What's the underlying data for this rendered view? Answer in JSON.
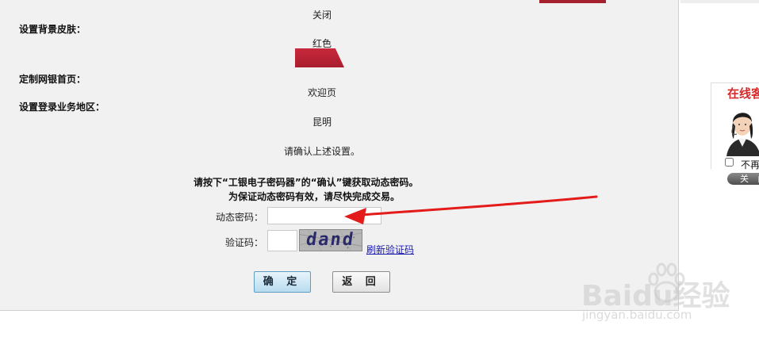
{
  "settings": {
    "skin_label": "设置背景皮肤：",
    "skin_off_value": "关闭",
    "skin_value": "红色",
    "home_label": "定制网银首页：",
    "home_value": "欢迎页",
    "region_label": "设置登录业务地区：",
    "region_value": "昆明"
  },
  "confirm_prompt": "请确认上述设置。",
  "instructions": {
    "line1": "请按下“工银电子密码器”的“确认”键获取动态密码。",
    "line2": "为保证动态密码有效，请尽快完成交易。"
  },
  "form": {
    "dynamic_password_label": "动态密码：",
    "dynamic_password_value": "",
    "captcha_label": "验证码：",
    "captcha_value": "",
    "captcha_image_text": "dand",
    "refresh_captcha_link": "刷新验证码"
  },
  "buttons": {
    "confirm_label": "确 定",
    "back_label": "返 回"
  },
  "service_widget": {
    "title": "在线客",
    "no_more_label": "不再",
    "close_label": "关 闭"
  },
  "watermark": {
    "main": "Baidu经验",
    "sub": "jingyan.baidu.com"
  },
  "colors": {
    "skin_red": "#c8283b",
    "arrow_red": "#e31b1b",
    "link_blue": "#1a1aaa",
    "panel_bg": "#f1f1f1"
  }
}
